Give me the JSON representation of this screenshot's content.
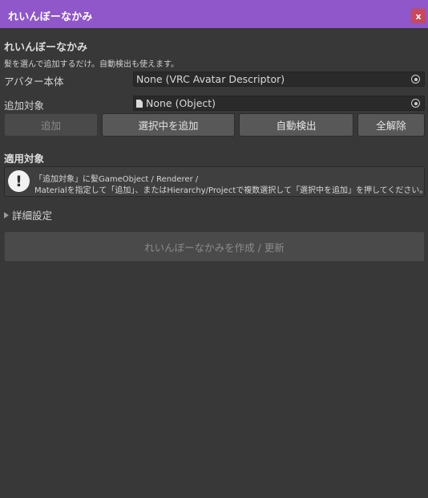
{
  "window": {
    "title": "れいんぼーなかみ",
    "close_label": "x"
  },
  "header": {
    "title": "れいんぼーなかみ",
    "description": "髪を選んで追加するだけ。自動検出も使えます。"
  },
  "fields": {
    "avatar": {
      "label": "アバター本体",
      "value": "None (VRC Avatar Descriptor)"
    },
    "target": {
      "label": "追加対象",
      "value": "None (Object)"
    }
  },
  "buttons": {
    "add": "追加",
    "add_selected": "選択中を追加",
    "auto_detect": "自動検出",
    "clear_all": "全解除"
  },
  "applied": {
    "title": "適用対象",
    "help_line1": "「追加対象」に髪GameObject / Renderer /",
    "help_line2": "Materialを指定して「追加」、またはHierarchy/Projectで複数選択して「選択中を追加」を押してください。"
  },
  "advanced": {
    "label": "詳細設定"
  },
  "create_button": "れいんぼーなかみを作成 / 更新",
  "colors": {
    "titlebar": "#8f57c9",
    "close": "#c9485a",
    "background": "#383838"
  }
}
